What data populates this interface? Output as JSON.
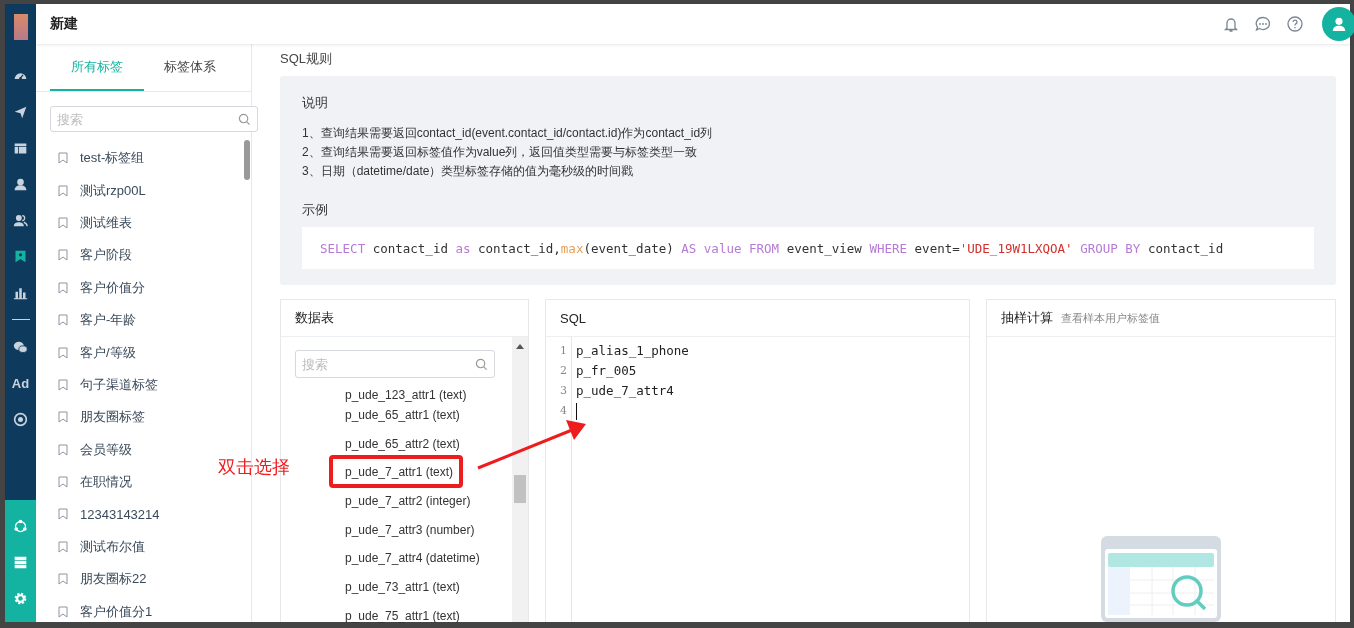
{
  "header": {
    "title": "新建"
  },
  "nav": {
    "items": [
      {
        "selected": false
      },
      {
        "selected": false
      },
      {
        "selected": false
      },
      {
        "selected": false
      },
      {
        "selected": false
      },
      {
        "selected": true
      },
      {
        "selected": false
      },
      {
        "selected": false
      },
      {
        "label": "Ad",
        "selected": false
      },
      {
        "selected": false
      }
    ]
  },
  "tag_panel": {
    "tabs": [
      {
        "label": "所有标签",
        "selected": true
      },
      {
        "label": "标签体系",
        "selected": false
      }
    ],
    "search": {
      "placeholder": "搜索"
    },
    "items": [
      "test-标签组",
      "测试rzp00L",
      "测试维表",
      "客户阶段",
      "客户价值分",
      "客户-年龄",
      "客户/等级",
      "句子渠道标签",
      "朋友圈标签",
      "会员等级",
      "在职情况",
      "12343143214",
      "测试布尔值",
      "朋友圈标22",
      "客户价值分1"
    ]
  },
  "sql_rules": {
    "title": "SQL规则",
    "notes_title": "说明",
    "notes": [
      "1、查询结果需要返回contact_id(event.contact_id/contact.id)作为contact_id列",
      "2、查询结果需要返回标签值作为value列，返回值类型需要与标签类型一致",
      "3、日期（datetime/date）类型标签存储的值为毫秒级的时间戳"
    ],
    "example_title": "示例",
    "example_tokens": [
      {
        "kind": "keyword",
        "text": "SELECT"
      },
      {
        "kind": "plain",
        "text": " contact_id "
      },
      {
        "kind": "keyword",
        "text": "as"
      },
      {
        "kind": "plain",
        "text": " contact_id,"
      },
      {
        "kind": "func",
        "text": "max"
      },
      {
        "kind": "plain",
        "text": "(event_date) "
      },
      {
        "kind": "keyword",
        "text": "AS value FROM"
      },
      {
        "kind": "plain",
        "text": " event_view "
      },
      {
        "kind": "keyword",
        "text": "WHERE"
      },
      {
        "kind": "plain",
        "text": " event="
      },
      {
        "kind": "string",
        "text": "'UDE_19W1LXQOA'"
      },
      {
        "kind": "keyword",
        "text": " GROUP BY"
      },
      {
        "kind": "plain",
        "text": " contact_id"
      }
    ]
  },
  "data_table": {
    "title": "数据表",
    "search": {
      "placeholder": "搜索"
    },
    "fields": [
      {
        "label": "p_ude_123_attr1 (text)",
        "highlighted": false
      },
      {
        "label": "p_ude_65_attr1 (text)",
        "highlighted": false
      },
      {
        "label": "p_ude_65_attr2 (text)",
        "highlighted": false
      },
      {
        "label": "p_ude_7_attr1 (text)",
        "highlighted": true
      },
      {
        "label": "p_ude_7_attr2 (integer)",
        "highlighted": false
      },
      {
        "label": "p_ude_7_attr3 (number)",
        "highlighted": false
      },
      {
        "label": "p_ude_7_attr4 (datetime)",
        "highlighted": false
      },
      {
        "label": "p_ude_73_attr1 (text)",
        "highlighted": false
      },
      {
        "label": "p_ude_75_attr1 (text)",
        "highlighted": false
      }
    ]
  },
  "sql_editor": {
    "title": "SQL",
    "lines": [
      {
        "number": "1",
        "text": "p_alias_1_phone"
      },
      {
        "number": "2",
        "text": "p_fr_005"
      },
      {
        "number": "3",
        "text": "p_ude_7_attr4"
      },
      {
        "number": "4"
      }
    ]
  },
  "sampling": {
    "title": "抽样计算",
    "subtitle": "查看样本用户标签值"
  },
  "annotation": {
    "text": "双击选择"
  }
}
